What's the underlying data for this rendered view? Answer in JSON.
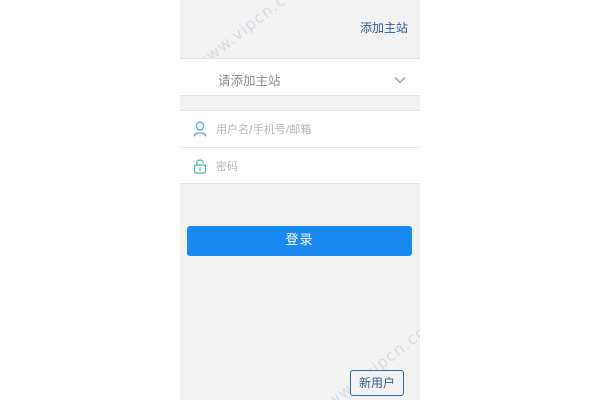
{
  "header": {
    "add_site_link": "添加主站"
  },
  "site_select": {
    "placeholder": "请添加主站",
    "chevron_icon": "chevron-down-icon"
  },
  "form": {
    "username": {
      "placeholder": "用户名/手机号/邮箱",
      "value": "",
      "icon": "user-icon"
    },
    "password": {
      "placeholder": "密码",
      "value": "",
      "icon": "lock-icon"
    }
  },
  "actions": {
    "login_label": "登录",
    "new_user_label": "新用户"
  },
  "watermark": {
    "text": "www.vipcn.com"
  },
  "colors": {
    "primary": "#1a8af3",
    "link": "#2f5f8f",
    "background": "#f2f2f3",
    "icon_user": "#5aa0d8",
    "icon_lock": "#49c19a"
  }
}
